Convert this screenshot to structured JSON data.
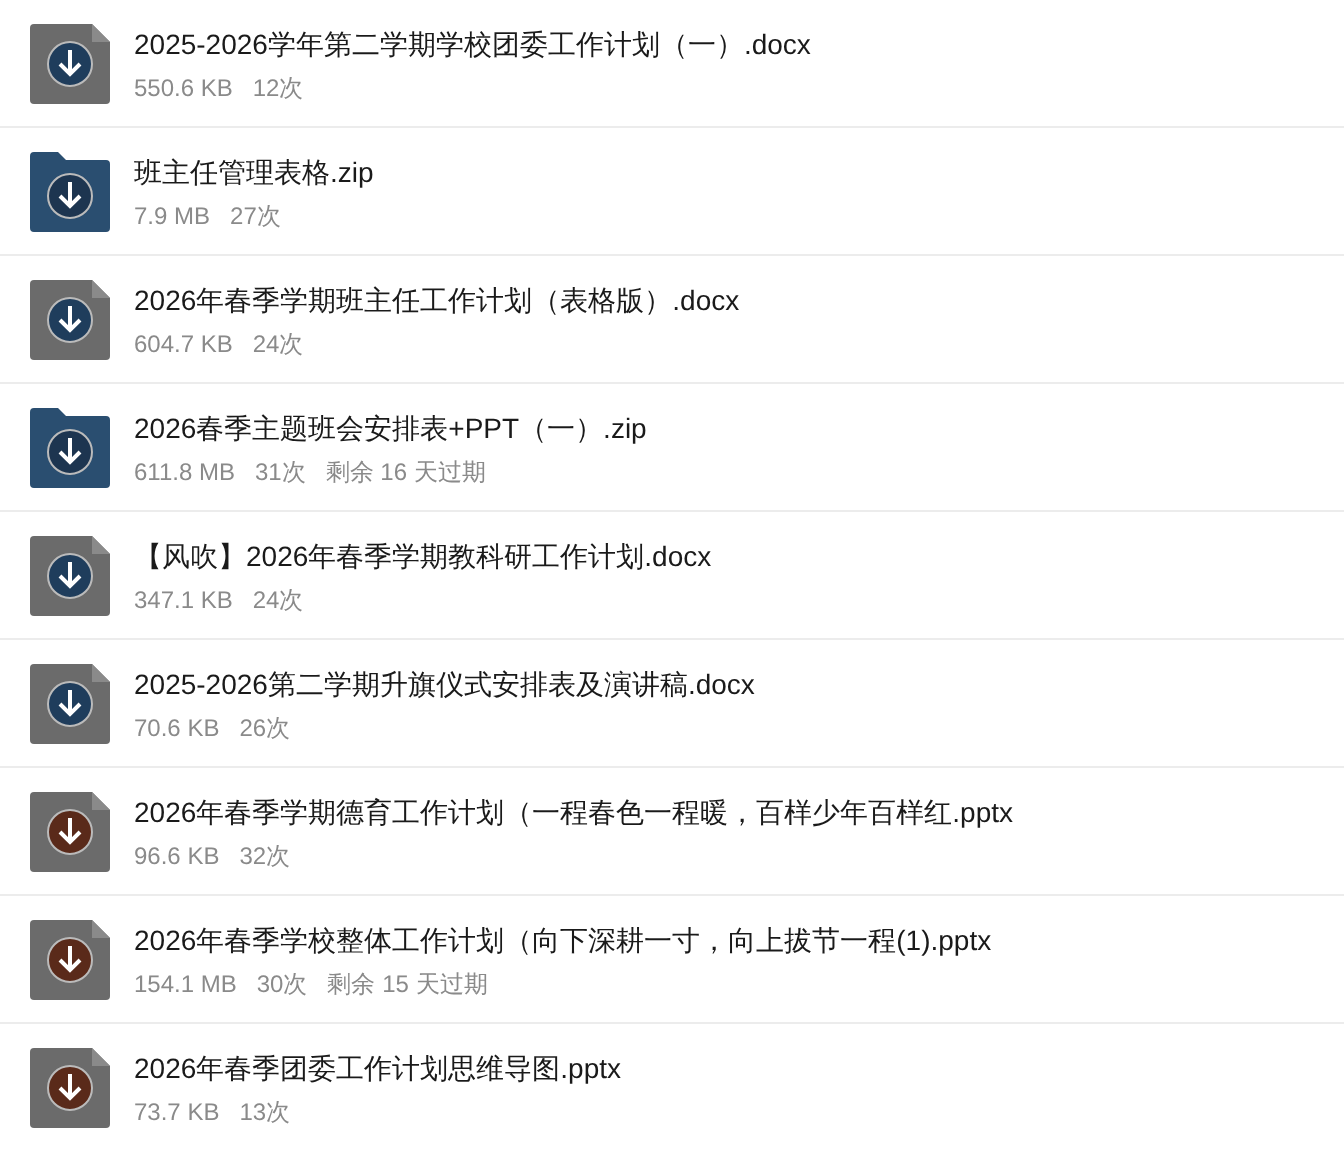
{
  "files": [
    {
      "kind": "doc",
      "name": "2025-2026学年第二学期学校团委工作计划（一）.docx",
      "size": "550.6 KB",
      "count": "12次"
    },
    {
      "kind": "zip",
      "name": "班主任管理表格.zip",
      "size": "7.9 MB",
      "count": "27次"
    },
    {
      "kind": "doc",
      "name": "2026年春季学期班主任工作计划（表格版）.docx",
      "size": "604.7 KB",
      "count": "24次"
    },
    {
      "kind": "zip",
      "name": "2026春季主题班会安排表+PPT（一）.zip",
      "size": "611.8 MB",
      "count": "31次",
      "expiry": "剩余 16 天过期"
    },
    {
      "kind": "doc",
      "name": "【风吹】2026年春季学期教科研工作计划.docx",
      "size": "347.1 KB",
      "count": "24次"
    },
    {
      "kind": "doc",
      "name": "2025-2026第二学期升旗仪式安排表及演讲稿.docx",
      "size": "70.6 KB",
      "count": "26次"
    },
    {
      "kind": "ppt",
      "name": "2026年春季学期德育工作计划（一程春色一程暖，百样少年百样红.pptx",
      "size": "96.6 KB",
      "count": "32次"
    },
    {
      "kind": "ppt",
      "name": "2026年春季学校整体工作计划（向下深耕一寸，向上拔节一程(1).pptx",
      "size": "154.1 MB",
      "count": "30次",
      "expiry": "剩余 15 天过期"
    },
    {
      "kind": "ppt",
      "name": "2026年春季团委工作计划思维导图.pptx",
      "size": "73.7 KB",
      "count": "13次"
    }
  ]
}
